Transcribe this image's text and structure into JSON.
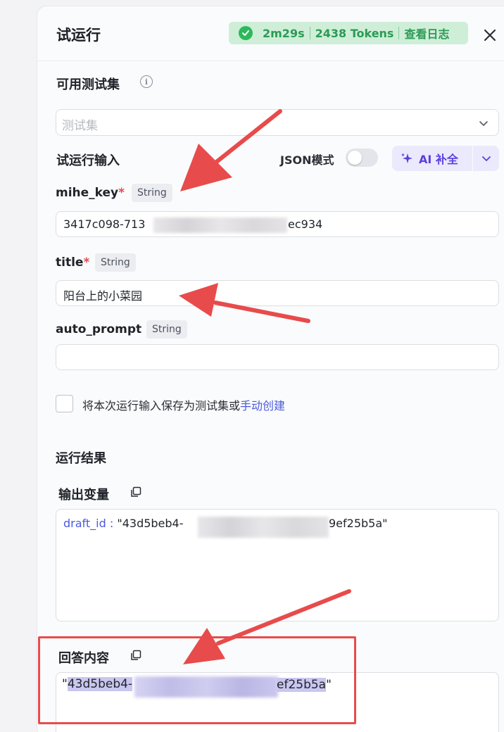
{
  "header": {
    "title": "试运行",
    "status": {
      "duration": "2m29s",
      "tokens": "2438 Tokens",
      "view_log": "查看日志"
    }
  },
  "test_set": {
    "label": "可用测试集",
    "placeholder": "测试集"
  },
  "run_input": {
    "label": "试运行输入",
    "json_mode_label": "JSON模式",
    "json_mode_on": false,
    "ai_fill_label": "AI 补全"
  },
  "fields": [
    {
      "name": "mihe_key",
      "required": "*",
      "type": "String",
      "value_prefix": "3417c098-713",
      "value_suffix": "ec934"
    },
    {
      "name": "title",
      "required": "*",
      "type": "String",
      "value": "阳台上的小菜园"
    },
    {
      "name": "auto_prompt",
      "required": "",
      "type": "String",
      "value": ""
    }
  ],
  "save_option": {
    "text": "将本次运行输入保存为测试集或",
    "link": "手动创建"
  },
  "results": {
    "label": "运行结果",
    "output_vars_label": "输出变量",
    "draft_key": "draft_id :",
    "draft_value_prefix": "\"43d5beb4-",
    "draft_value_suffix": "9ef25b5a\"",
    "answer_label": "回答内容",
    "answer_quote_open": "\"",
    "answer_prefix": "43d5beb4-",
    "answer_suffix": "ef25b5a",
    "answer_quote_close": "\""
  },
  "colors": {
    "accent_green": "#2eb85c",
    "ai_purple": "#5b3fe0",
    "link_blue": "#4b5adb",
    "annotation_red": "#e84b4b"
  }
}
